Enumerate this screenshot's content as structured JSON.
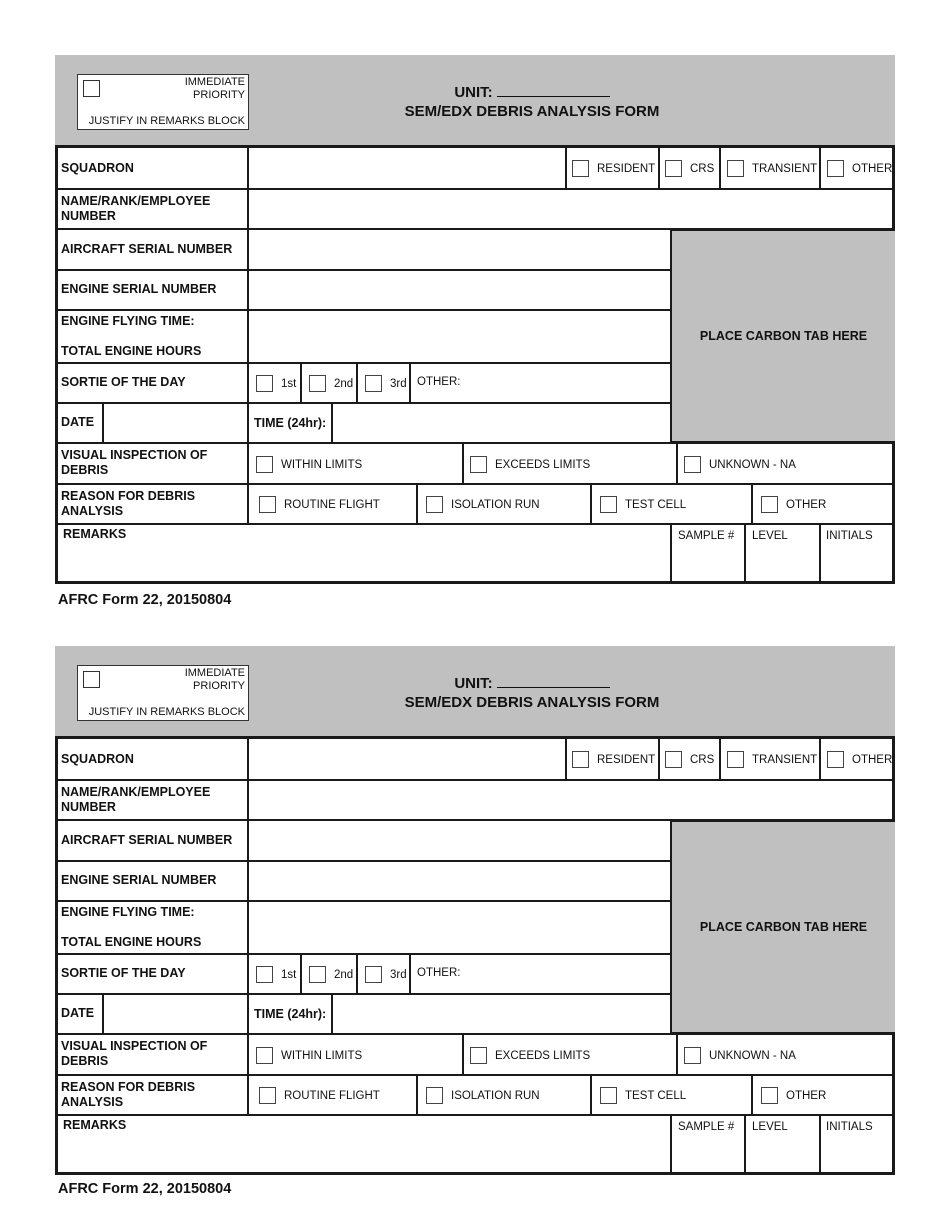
{
  "forms": [
    {
      "priority_box": {
        "line1": "IMMEDIATE",
        "line2": "PRIORITY",
        "line3": "JUSTIFY IN REMARKS BLOCK"
      },
      "title": {
        "unit_label": "UNIT:",
        "form_title": "SEM/EDX DEBRIS ANALYSIS FORM"
      },
      "labels": {
        "squadron": "SQUADRON",
        "name_rank_1": "NAME/RANK/EMPLOYEE",
        "name_rank_2": "NUMBER",
        "aircraft_serial": "AIRCRAFT SERIAL NUMBER",
        "engine_serial": "ENGINE SERIAL NUMBER",
        "engine_flying_time": "ENGINE FLYING TIME:",
        "total_engine_hours": "TOTAL ENGINE HOURS",
        "sortie": "SORTIE OF THE DAY",
        "date": "DATE",
        "time": "TIME (24hr):",
        "visual_1": "VISUAL INSPECTION OF",
        "visual_2": "DEBRIS",
        "reason_1": "REASON FOR DEBRIS",
        "reason_2": "ANALYSIS",
        "remarks": "REMARKS",
        "sample": "SAMPLE #",
        "level": "LEVEL",
        "initials": "INITIALS",
        "carbon_tab": "PLACE CARBON TAB HERE"
      },
      "squadron_options": [
        "RESIDENT",
        "CRS",
        "TRANSIENT",
        "OTHER"
      ],
      "sortie_options": [
        "1st",
        "2nd",
        "3rd"
      ],
      "sortie_other": "OTHER:",
      "visual_options": [
        "WITHIN LIMITS",
        "EXCEEDS LIMITS",
        "UNKNOWN - NA"
      ],
      "reason_options": [
        "ROUTINE FLIGHT",
        "ISOLATION RUN",
        "TEST CELL",
        "OTHER"
      ],
      "footer": "AFRC Form 22, 20150804"
    },
    {
      "priority_box": {
        "line1": "IMMEDIATE",
        "line2": "PRIORITY",
        "line3": "JUSTIFY IN REMARKS BLOCK"
      },
      "title": {
        "unit_label": "UNIT:",
        "form_title": "SEM/EDX DEBRIS ANALYSIS FORM"
      },
      "labels": {
        "squadron": "SQUADRON",
        "name_rank_1": "NAME/RANK/EMPLOYEE",
        "name_rank_2": "NUMBER",
        "aircraft_serial": "AIRCRAFT SERIAL NUMBER",
        "engine_serial": "ENGINE SERIAL NUMBER",
        "engine_flying_time": "ENGINE FLYING TIME:",
        "total_engine_hours": "TOTAL ENGINE HOURS",
        "sortie": "SORTIE OF THE DAY",
        "date": "DATE",
        "time": "TIME (24hr):",
        "visual_1": "VISUAL INSPECTION OF",
        "visual_2": "DEBRIS",
        "reason_1": "REASON FOR DEBRIS",
        "reason_2": "ANALYSIS",
        "remarks": "REMARKS",
        "sample": "SAMPLE #",
        "level": "LEVEL",
        "initials": "INITIALS",
        "carbon_tab": "PLACE CARBON TAB HERE"
      },
      "squadron_options": [
        "RESIDENT",
        "CRS",
        "TRANSIENT",
        "OTHER"
      ],
      "sortie_options": [
        "1st",
        "2nd",
        "3rd"
      ],
      "sortie_other": "OTHER:",
      "visual_options": [
        "WITHIN LIMITS",
        "EXCEEDS LIMITS",
        "UNKNOWN - NA"
      ],
      "reason_options": [
        "ROUTINE FLIGHT",
        "ISOLATION RUN",
        "TEST CELL",
        "OTHER"
      ],
      "footer": "AFRC Form 22, 20150804"
    }
  ]
}
